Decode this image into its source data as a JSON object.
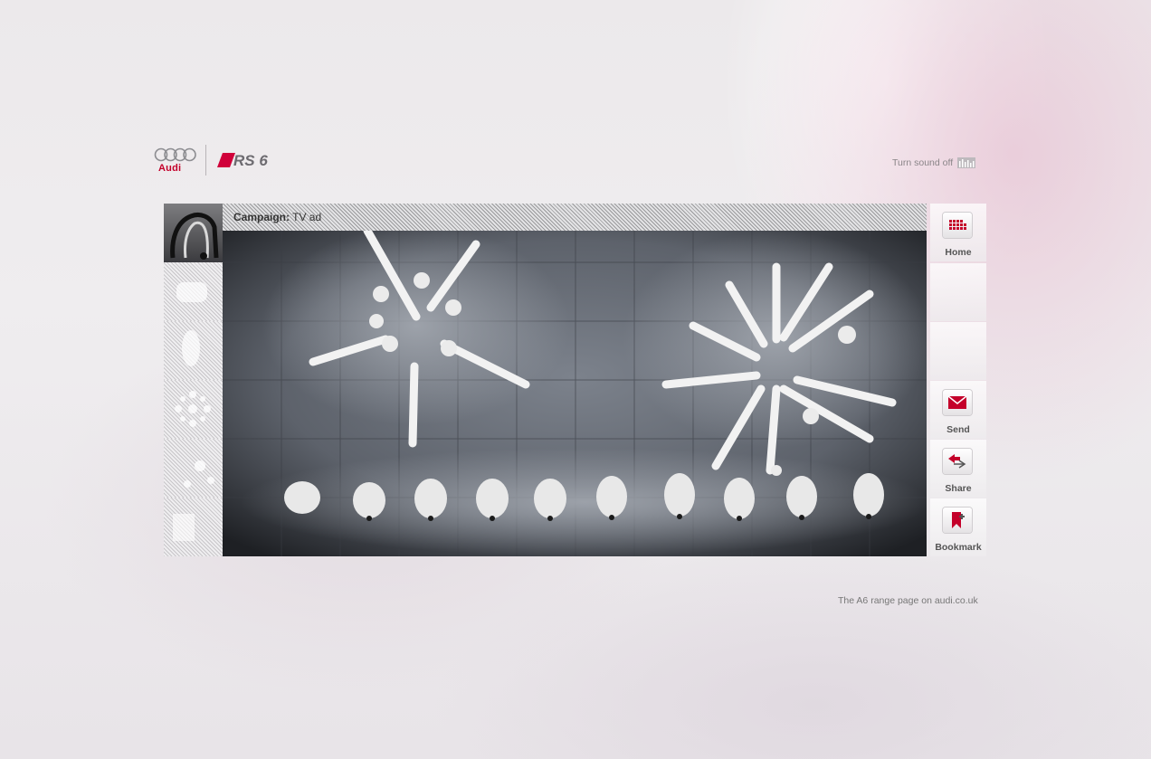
{
  "brand": {
    "audi_wordmark": "Audi",
    "model_logo": "RS 6"
  },
  "header": {
    "sound_toggle_label": "Turn sound off",
    "sound_icon": "equalizer-icon"
  },
  "video": {
    "title_prefix": "Campaign:",
    "title_value": "TV ad"
  },
  "thumbnails": [
    {
      "name": "thumb-1",
      "active": true
    },
    {
      "name": "thumb-2"
    },
    {
      "name": "thumb-3"
    },
    {
      "name": "thumb-4"
    },
    {
      "name": "thumb-5"
    },
    {
      "name": "thumb-6"
    }
  ],
  "sidebar": {
    "home": {
      "label": "Home",
      "icon": "grid-icon"
    },
    "send": {
      "label": "Send",
      "icon": "envelope-icon"
    },
    "share": {
      "label": "Share",
      "icon": "share-arrows-icon"
    },
    "bookmark": {
      "label": "Bookmark",
      "icon": "bookmark-icon"
    }
  },
  "footer": {
    "range_link": "The A6 range page on audi.co.uk"
  },
  "colors": {
    "accent_red": "#c4002a",
    "text_gray": "#777777"
  }
}
